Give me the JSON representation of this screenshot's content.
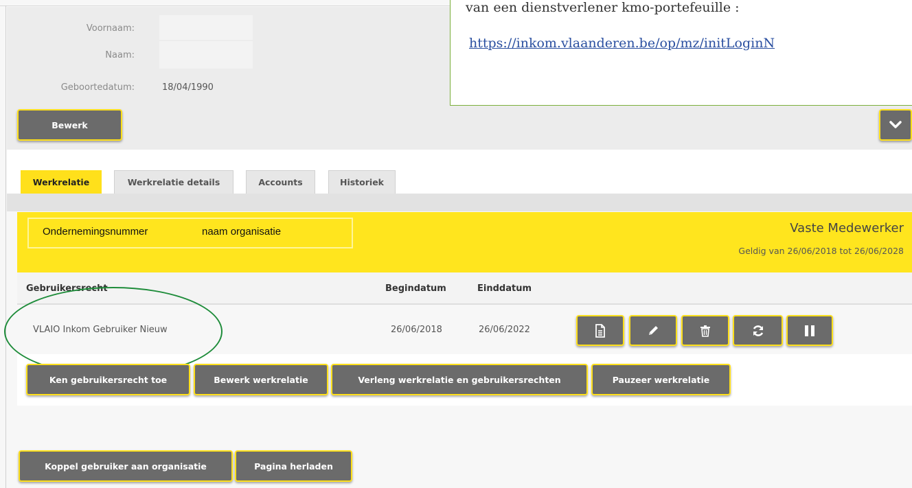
{
  "profile": {
    "first_name_label": "Voornaam:",
    "last_name_label": "Naam:",
    "birthdate_label": "Geboortedatum:",
    "birthdate_value": "18/04/1990",
    "edit_button": "Bewerk"
  },
  "tabs": [
    {
      "label": "Werkrelatie",
      "active": true
    },
    {
      "label": "Werkrelatie details",
      "active": false
    },
    {
      "label": "Accounts",
      "active": false
    },
    {
      "label": "Historiek",
      "active": false
    }
  ],
  "relation": {
    "enterprise_number_label": "Ondernemingsnummer",
    "organisation_name": "naam organisatie",
    "role": "Vaste Medewerker",
    "validity": "Geldig van 26/06/2018 tot 26/06/2028"
  },
  "table": {
    "headers": [
      "Gebruikersrecht",
      "Begindatum",
      "Einddatum"
    ],
    "rows": [
      {
        "right": "VLAIO Inkom Gebruiker Nieuw",
        "start": "26/06/2018",
        "end": "26/06/2022"
      }
    ],
    "row_actions": [
      "document-icon",
      "pencil-icon",
      "trash-icon",
      "refresh-icon",
      "pause-icon"
    ]
  },
  "actions": {
    "assign_right": "Ken gebruikersrecht toe",
    "edit_relation": "Bewerk werkrelatie",
    "extend_relation": "Verleng werkrelatie en gebruikersrechten",
    "pause_relation": "Pauzeer werkrelatie"
  },
  "footer": {
    "link_user": "Koppel gebruiker aan organisatie",
    "reload": "Pagina herladen"
  },
  "callout": {
    "text": "van een dienstverlener kmo-portefeuille :",
    "link": "https://inkom.vlaanderen.be/op/mz/initLoginN"
  },
  "colors": {
    "accent_yellow": "#ffe51e",
    "button_gray": "#6b6b6b",
    "annotation_green": "#1e8c3a"
  }
}
